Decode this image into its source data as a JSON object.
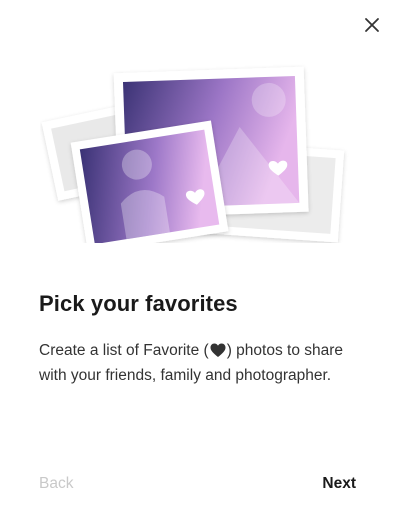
{
  "dialog": {
    "title": "Pick your favorites",
    "description_before_icon": "Create a list of Favorite (",
    "description_after_icon": ") photos to share with your friends, family and photographer.",
    "inline_icon": "heart-icon"
  },
  "buttons": {
    "close_icon": "close-icon",
    "back_label": "Back",
    "next_label": "Next"
  },
  "colors": {
    "title": "#1a1a1a",
    "body_text": "#333333",
    "back_disabled": "#c9c9c9",
    "photo_gradient_start": "#3b3375",
    "photo_gradient_end": "#e6b6ec",
    "placeholder_photo": "#e9e9e9"
  },
  "illustration": {
    "icons": [
      "photo-stack-icon",
      "portrait-photo-icon",
      "landscape-photo-icon",
      "heart-icon"
    ]
  }
}
